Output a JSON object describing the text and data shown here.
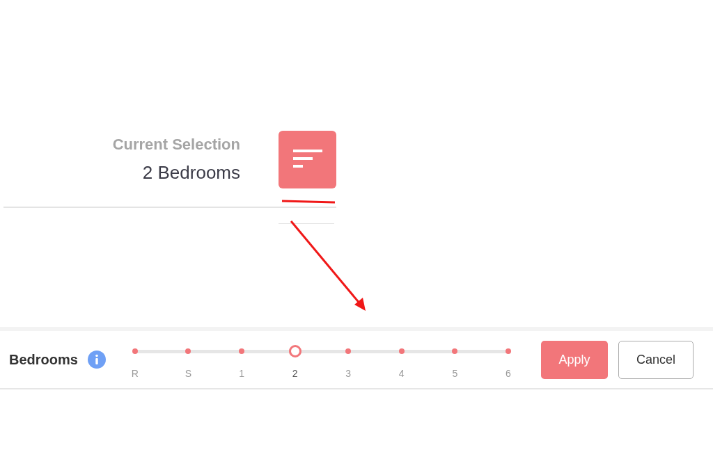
{
  "current_selection": {
    "label": "Current Selection",
    "value": "2 Bedrooms"
  },
  "filter_bar": {
    "label": "Bedrooms",
    "stops": [
      {
        "label": "R",
        "selected": false
      },
      {
        "label": "S",
        "selected": false
      },
      {
        "label": "1",
        "selected": false
      },
      {
        "label": "2",
        "selected": true
      },
      {
        "label": "3",
        "selected": false
      },
      {
        "label": "4",
        "selected": false
      },
      {
        "label": "5",
        "selected": false
      },
      {
        "label": "6",
        "selected": false
      }
    ],
    "buttons": [
      {
        "label": "Apply",
        "kind": "primary"
      },
      {
        "label": "Cancel",
        "kind": "secondary"
      }
    ]
  }
}
